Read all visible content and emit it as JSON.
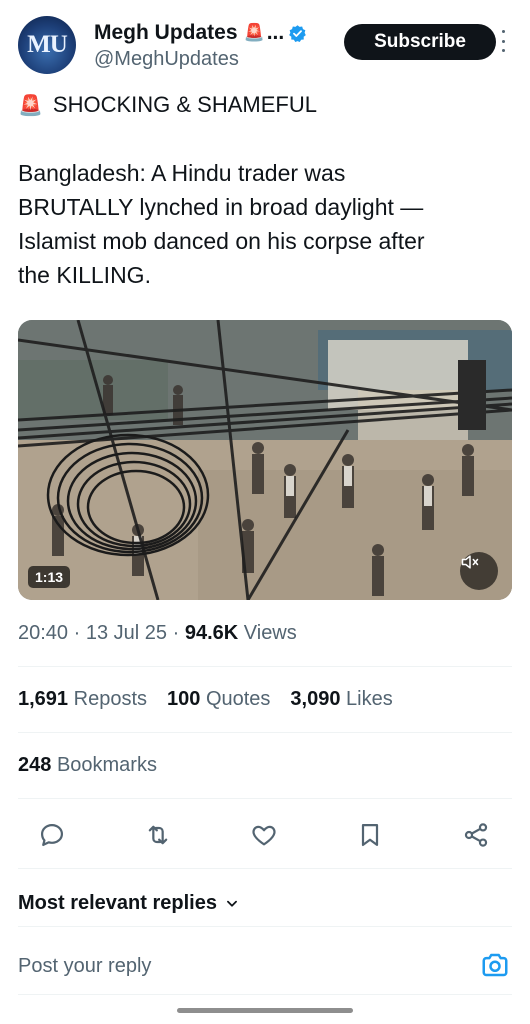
{
  "author": {
    "avatar_text": "MU",
    "name": "Megh Updates",
    "name_emoji": "🚨",
    "name_ellipsis": "...",
    "handle": "@MeghUpdates",
    "verified_icon": "verified-badge-icon"
  },
  "header": {
    "subscribe_label": "Subscribe",
    "more_icon": "more-vertical-icon"
  },
  "post": {
    "headline_emoji": "🚨",
    "headline": "SHOCKING & SHAMEFUL",
    "body_lines": [
      "Bangladesh: A Hindu trader was",
      "BRUTALLY lynched in broad daylight —",
      "Islamist mob danced on his corpse after",
      "the KILLING."
    ]
  },
  "media": {
    "duration": "1:13",
    "mute_icon": "volume-muted-icon"
  },
  "meta": {
    "time": "20:40",
    "sep1": "·",
    "date": "13 Jul 25",
    "sep2": "·",
    "views_count": "94.6K",
    "views_label": "Views"
  },
  "stats": {
    "reposts_count": "1,691",
    "reposts_label": "Reposts",
    "quotes_count": "100",
    "quotes_label": "Quotes",
    "likes_count": "3,090",
    "likes_label": "Likes",
    "bookmarks_count": "248",
    "bookmarks_label": "Bookmarks"
  },
  "actions": [
    "reply-icon",
    "repost-icon",
    "like-icon",
    "bookmark-icon",
    "share-icon"
  ],
  "replies": {
    "sort_label": "Most relevant replies",
    "reply_placeholder": "Post your reply",
    "camera_icon": "camera-icon"
  },
  "colors": {
    "text": "#0f1419",
    "secondary": "#536471",
    "accent": "#1d9bf0",
    "divider": "#eff3f4"
  }
}
